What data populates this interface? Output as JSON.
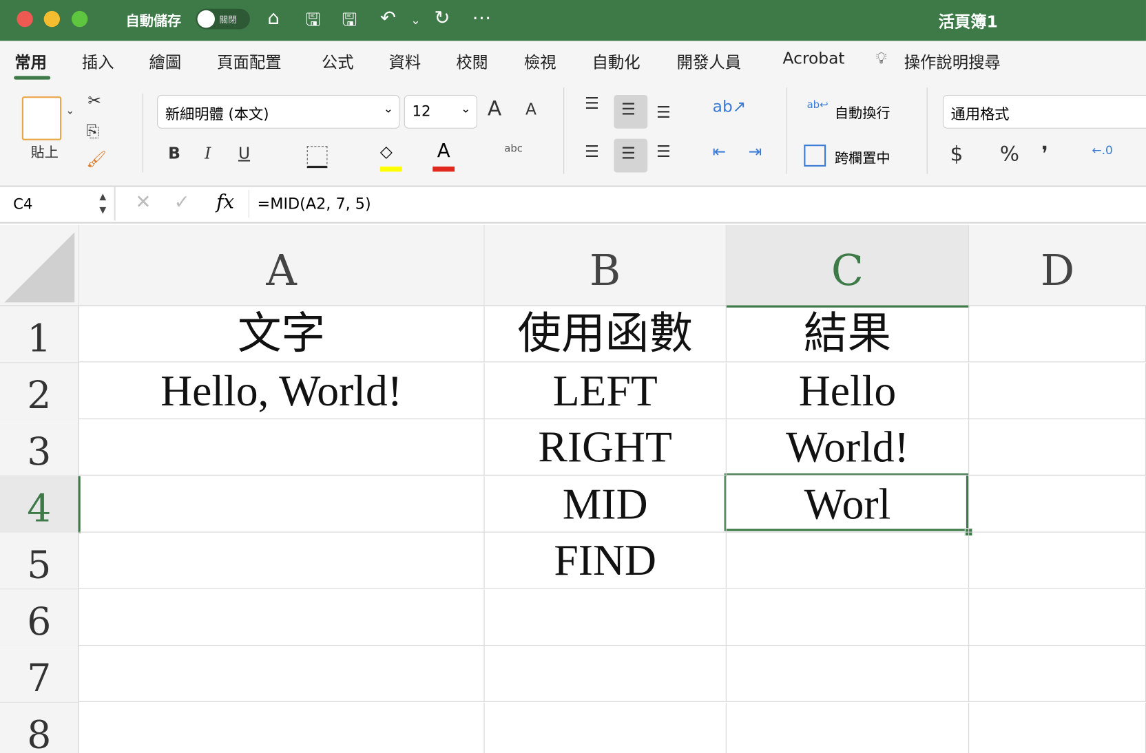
{
  "titlebar": {
    "autosave_label": "自動儲存",
    "autosave_state": "關閉",
    "workbook_title": "活頁簿1"
  },
  "tabs": [
    "常用",
    "插入",
    "繪圖",
    "頁面配置",
    "公式",
    "資料",
    "校閱",
    "檢視",
    "自動化",
    "開發人員",
    "Acrobat",
    "操作說明搜尋"
  ],
  "active_tab": "常用",
  "ribbon": {
    "paste_label": "貼上",
    "font_name": "新細明體 (本文)",
    "font_size": "12",
    "wrap_text": "自動換行",
    "merge_center": "跨欄置中",
    "number_format": "通用格式",
    "currency": "$",
    "percent": "%",
    "comma": "❜",
    "bold": "B",
    "italic": "I",
    "underline": "U",
    "grow_font": "A",
    "shrink_font": "A",
    "abc": "abc"
  },
  "colors": {
    "accent": "#3d7a48",
    "highlight": "#ffff00",
    "font_color": "#e0281e"
  },
  "formula_bar": {
    "name_box": "C4",
    "fx": "fx",
    "formula": "=MID(A2, 7, 5)"
  },
  "columns": [
    "A",
    "B",
    "C",
    "D"
  ],
  "rows": [
    "1",
    "2",
    "3",
    "4",
    "5",
    "6",
    "7",
    "8"
  ],
  "cells": {
    "A1": "文字",
    "B1": "使用函數",
    "C1": "結果",
    "A2": "Hello, World!",
    "B2": "LEFT",
    "C2": "Hello",
    "B3": "RIGHT",
    "C3": "World!",
    "B4": "MID",
    "C4": "Worl",
    "B5": "FIND"
  },
  "selected_cell": "C4"
}
